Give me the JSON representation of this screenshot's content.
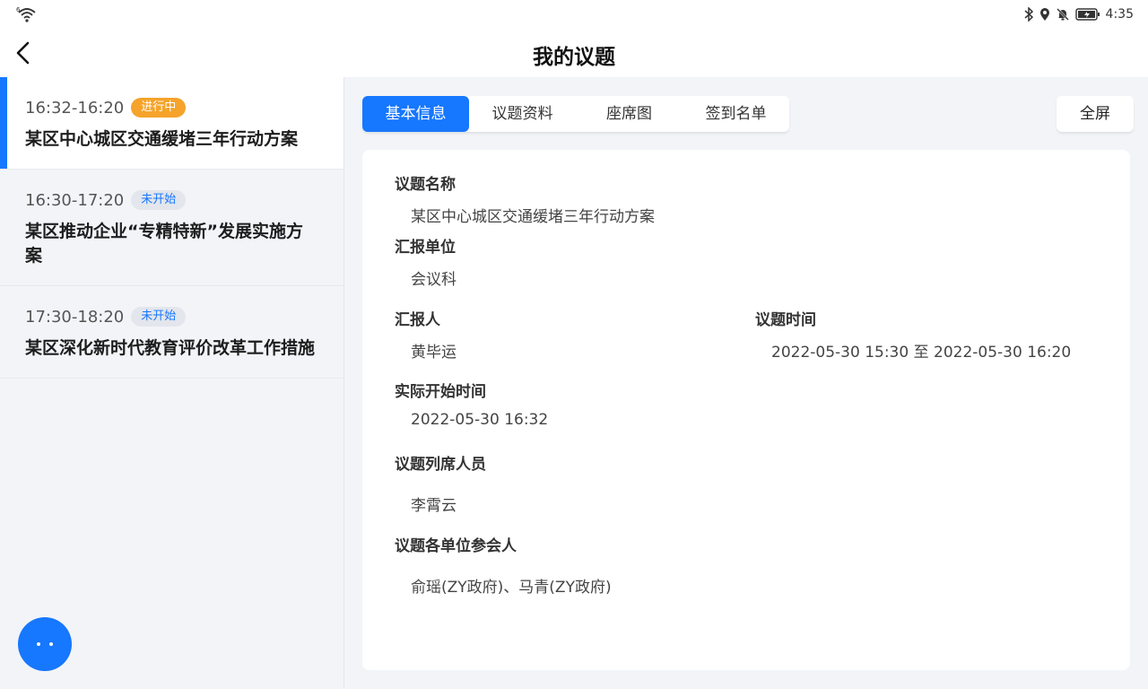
{
  "statusbar": {
    "wifi_icon": "wifi-icon",
    "time": "4:35"
  },
  "header": {
    "title": "我的议题"
  },
  "agenda": [
    {
      "time": "16:32-16:20",
      "status": "进行中",
      "title": "某区中心城区交通缓堵三年行动方案"
    },
    {
      "time": "16:30-17:20",
      "status": "未开始",
      "title": "某区推动企业“专精特新”发展实施方案"
    },
    {
      "time": "17:30-18:20",
      "status": "未开始",
      "title": "某区深化新时代教育评价改革工作措施"
    }
  ],
  "tabs": [
    "基本信息",
    "议题资料",
    "座席图",
    "签到名单"
  ],
  "fullscreen_label": "全屏",
  "info": {
    "name_label": "议题名称",
    "name_value": "某区中心城区交通缓堵三年行动方案",
    "unit_label": "汇报单位",
    "unit_value": "会议科",
    "reporter_label": "汇报人",
    "reporter_value": "黄毕运",
    "time_label": "议题时间",
    "time_value": "2022-05-30 15:30 至 2022-05-30 16:20",
    "start_label": "实际开始时间",
    "start_value": "2022-05-30 16:32",
    "attendees_label": "议题列席人员",
    "attendees_value": "李霄云",
    "participants_label": "议题各单位参会人",
    "participants_value": "俞瑶(ZY政府)、马青(ZY政府)"
  },
  "colors": {
    "accent": "#1677ff",
    "ongoing": "#f5a32a",
    "background": "#f2f4f8"
  }
}
